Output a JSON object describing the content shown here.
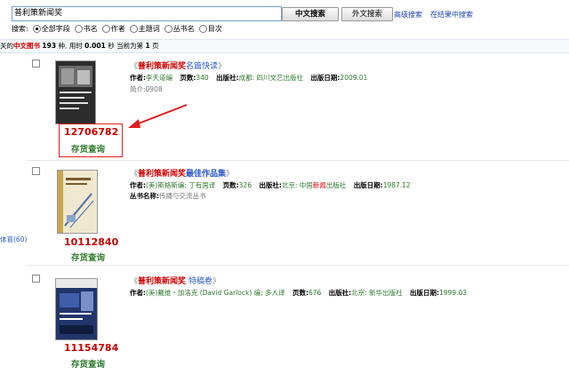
{
  "search": {
    "query": "普利策新闻奖",
    "btn_cn": "中文搜索",
    "btn_en": "外文搜索",
    "advanced": "高级搜索",
    "in_results": "在结果中搜索",
    "scope_label": "搜索:",
    "options": [
      "全部字段",
      "书名",
      "作者",
      "主题词",
      "丛书名",
      "目次"
    ],
    "selected": "全部字段"
  },
  "summary": {
    "prefix": "关的",
    "type": "中文图书",
    "count": "193",
    "mid": "种, 用时",
    "time": "0.001",
    "unit": "秒",
    "page_label": "当前为第",
    "page": "1",
    "page_unit": "页"
  },
  "left_edge_label": "体育(60)",
  "items": [
    {
      "title_open": "《",
      "title_kw": "普利策新闻奖",
      "title_rest": "名篇快读",
      "title_close": "》",
      "author_label": "作者:",
      "author": "李天道编",
      "pages_label": "页数:",
      "pages": "340",
      "publisher_label": "出版社:",
      "publisher": "成都: 四川文艺出版社",
      "date_label": "出版日期:",
      "date": "2009.01",
      "extra_label": "简介:",
      "extra": "0908",
      "code": "12706782",
      "stock": "存货查询",
      "cover_text": "普利策新闻奖"
    },
    {
      "title_open": "《",
      "title_kw": "普利策新闻奖",
      "title_rest": "最佳作品集",
      "title_close": "》",
      "author_label": "作者:",
      "author": "(美)斯格斯编; 丁有国译",
      "pages_label": "页数:",
      "pages": "326",
      "publisher_label": "出版社:",
      "publisher_pre": "北京: 中国",
      "publisher_kw": "新闻",
      "publisher_post": "出版社",
      "date_label": "出版日期:",
      "date": "1987.12",
      "extra_label": "丛书名称:",
      "extra": "传播与交流丛书",
      "code": "10112840",
      "stock": "存货查询"
    },
    {
      "title_open": "《",
      "title_kw": "普利策新闻奖",
      "title_rest": "特稿卷",
      "title_close": "》",
      "author_label": "作者:",
      "author": "(美)戴维・加洛克 (David Garlock) 编; 多人译",
      "pages_label": "页数:",
      "pages": "676",
      "publisher_label": "出版社:",
      "publisher": "北京: 新华出版社",
      "date_label": "出版日期:",
      "date": "1999.03",
      "code": "11154784",
      "stock": "存货查询",
      "cover_text": "普利策新闻奖"
    }
  ]
}
